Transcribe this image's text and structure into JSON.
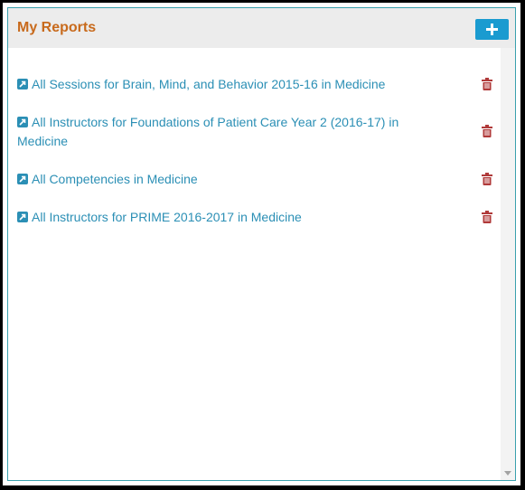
{
  "panel": {
    "title": "My Reports",
    "add_button_icon": "plus-icon"
  },
  "reports": [
    {
      "label": "All Sessions for Brain, Mind, and Behavior 2015-16 in Medicine",
      "icon": "external-link-icon",
      "delete_icon": "trash-icon"
    },
    {
      "label": "All Instructors for Foundations of Patient Care Year 2 (2016-17) in Medicine",
      "icon": "external-link-icon",
      "delete_icon": "trash-icon"
    },
    {
      "label": "All Competencies in Medicine",
      "icon": "external-link-icon",
      "delete_icon": "trash-icon"
    },
    {
      "label": "All Instructors for PRIME 2016-2017 in Medicine",
      "icon": "external-link-icon",
      "delete_icon": "trash-icon"
    }
  ],
  "colors": {
    "title": "#c86a1c",
    "link": "#2b8fb5",
    "add_button": "#1a9bd0",
    "trash": "#b03a3a",
    "border": "#3aa0ad"
  }
}
